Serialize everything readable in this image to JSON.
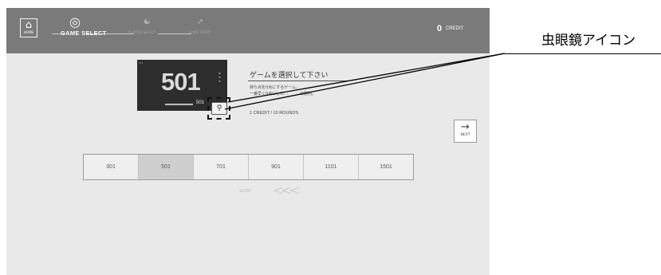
{
  "header": {
    "home_label": "HOME",
    "steps": [
      {
        "label": "GAME SELECT",
        "active": true
      },
      {
        "label": "PLAYER SELECT",
        "active": false
      },
      {
        "label": "GAME START",
        "active": false
      }
    ],
    "credit_value": "0",
    "credit_label": "CREDIT"
  },
  "preview": {
    "corner_text": "501",
    "score": "501",
    "bar_value": "501"
  },
  "info": {
    "title": "ゲームを選択して下さい",
    "desc_line1": "持ち点を0点にするゲーム。",
    "desc_line2": "一番早く0点にした…　　…の勝利。",
    "rounds": "1 CREDIT / 10 ROUNDS"
  },
  "next_label": "NEXT",
  "games": [
    "301",
    "501",
    "701",
    "901",
    "1101",
    "1501"
  ],
  "selected_game": "501",
  "slide": {
    "label": "SLIDE",
    "arrows": "<<<"
  },
  "callout": {
    "label": "虫眼鏡アイコン"
  },
  "colors": {
    "topbar": "#7a7a7a",
    "background": "#e9e9e9",
    "selected": "#cfcfcf"
  },
  "icons": {
    "home": "home-icon",
    "step_game": "target-icon",
    "step_player": "person-icon",
    "step_start": "dart-icon",
    "next": "arrow-right-icon",
    "magnifier": "magnifier-icon"
  }
}
